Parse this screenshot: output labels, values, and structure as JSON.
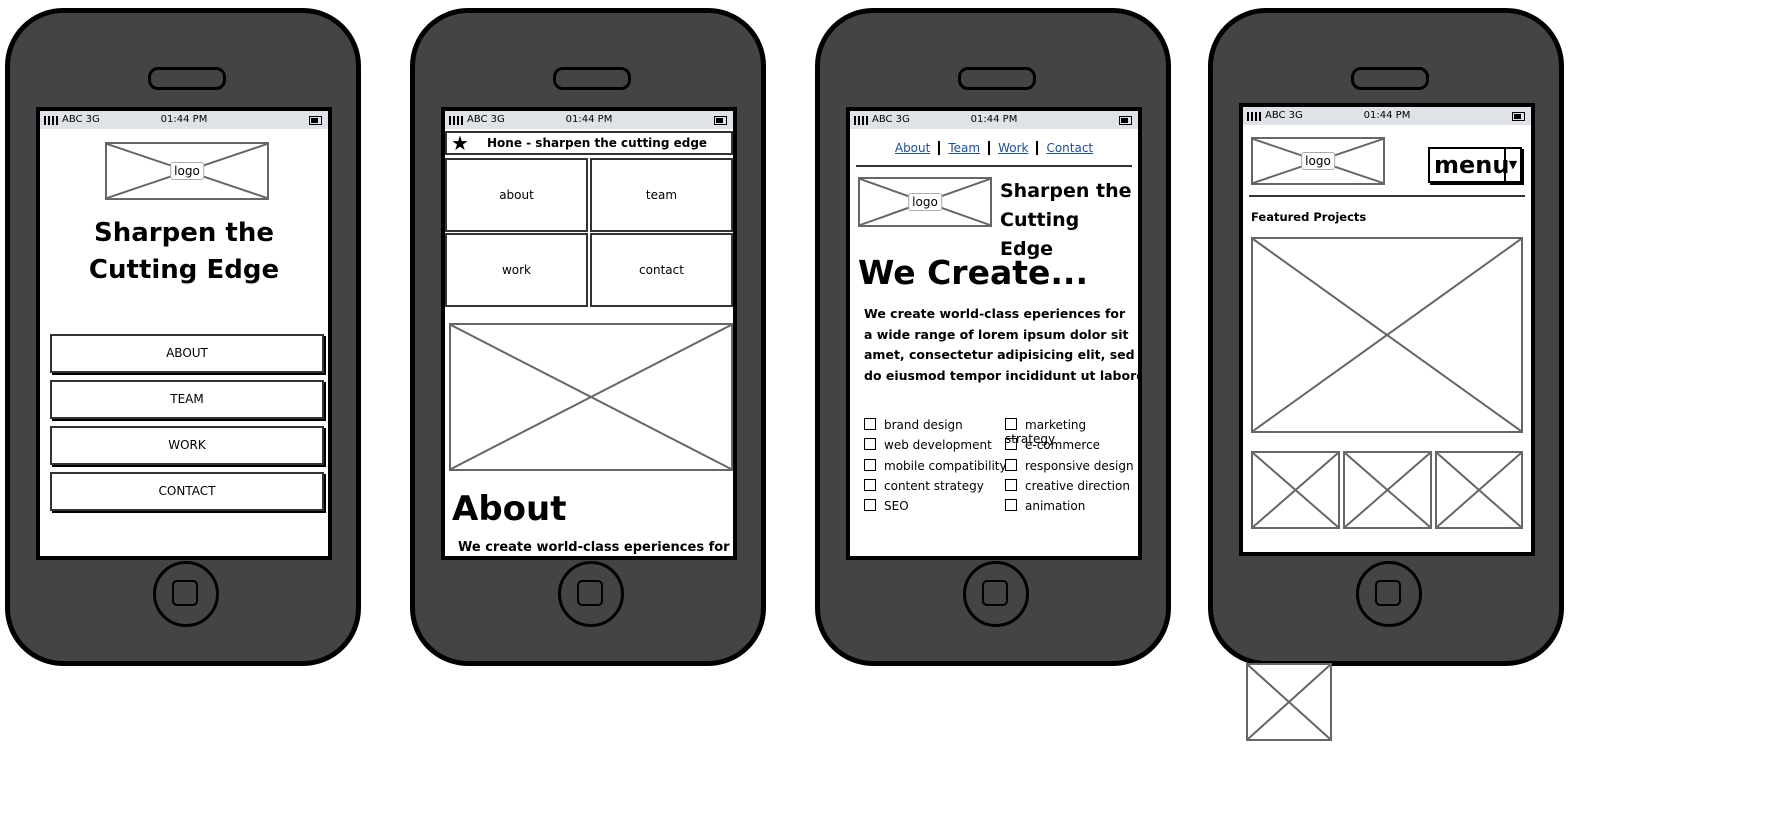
{
  "status": {
    "carrier": "ABC 3G",
    "time": "01:44 PM"
  },
  "phone1": {
    "logo": "logo",
    "title": [
      "Sharpen the",
      "Cutting Edge"
    ],
    "buttons": [
      "ABOUT",
      "TEAM",
      "WORK",
      "CONTACT"
    ]
  },
  "phone2": {
    "header": "Hone - sharpen the cutting edge",
    "tiles": [
      "about",
      "team",
      "work",
      "contact"
    ],
    "heading": "About",
    "body": "We create world-class eperiences for"
  },
  "phone3": {
    "nav": [
      "About",
      "Team",
      "Work",
      "Contact"
    ],
    "logo": "logo",
    "title": [
      "Sharpen the",
      "Cutting Edge"
    ],
    "heading": "We Create...",
    "body": [
      "We create world-class eperiences for",
      "a wide range of lorem ipsum dolor sit",
      "amet, consectetur adipisicing elit, sed",
      "do eiusmod tempor incididunt ut labore"
    ],
    "checks_left": [
      "brand design",
      "web development",
      "mobile compatibility",
      "content strategy",
      "SEO"
    ],
    "checks_right": [
      "marketing strategy",
      "e-commerce",
      "responsive design",
      "creative direction",
      "animation"
    ]
  },
  "phone4": {
    "logo": "logo",
    "menu": "menu",
    "section": "Featured Projects"
  },
  "colors": {
    "body": "#444444",
    "status_bar": "#dfe3e7",
    "link": "#1f4e8c"
  }
}
